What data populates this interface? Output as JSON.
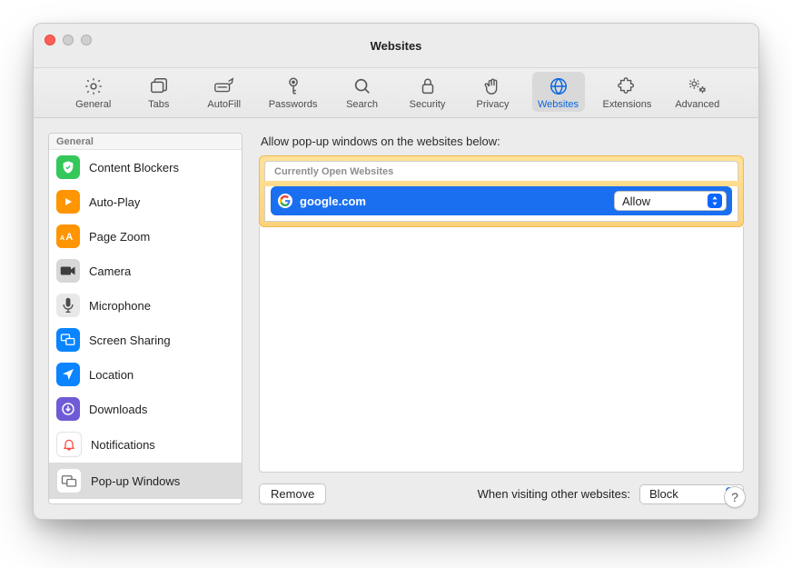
{
  "window": {
    "title": "Websites"
  },
  "toolbar": {
    "items": [
      {
        "label": "General",
        "icon": "gear-icon"
      },
      {
        "label": "Tabs",
        "icon": "tabs-icon"
      },
      {
        "label": "AutoFill",
        "icon": "autofill-icon"
      },
      {
        "label": "Passwords",
        "icon": "key-icon"
      },
      {
        "label": "Search",
        "icon": "search-icon"
      },
      {
        "label": "Security",
        "icon": "lock-icon"
      },
      {
        "label": "Privacy",
        "icon": "hand-icon"
      },
      {
        "label": "Websites",
        "icon": "globe-icon",
        "selected": true
      },
      {
        "label": "Extensions",
        "icon": "puzzle-icon"
      },
      {
        "label": "Advanced",
        "icon": "gears-icon"
      }
    ]
  },
  "sidebar": {
    "header": "General",
    "items": [
      {
        "label": "Content Blockers",
        "icon": "shield-icon",
        "bg": "#34c759"
      },
      {
        "label": "Auto-Play",
        "icon": "play-icon",
        "bg": "#ff9500"
      },
      {
        "label": "Page Zoom",
        "icon": "zoom-icon",
        "bg": "#ff9500"
      },
      {
        "label": "Camera",
        "icon": "camera-icon",
        "bg": "#5c5c5c"
      },
      {
        "label": "Microphone",
        "icon": "mic-icon",
        "bg": "#d5d5d5"
      },
      {
        "label": "Screen Sharing",
        "icon": "screenshare-icon",
        "bg": "#0a84ff"
      },
      {
        "label": "Location",
        "icon": "location-icon",
        "bg": "#0a84ff"
      },
      {
        "label": "Downloads",
        "icon": "download-icon",
        "bg": "#7e5bef"
      },
      {
        "label": "Notifications",
        "icon": "bell-icon",
        "bg": "#ffffff"
      },
      {
        "label": "Pop-up Windows",
        "icon": "popup-icon",
        "bg": "#ffffff",
        "selected": true
      }
    ]
  },
  "panel": {
    "heading": "Allow pop-up windows on the websites below:",
    "list_header": "Currently Open Websites",
    "rows": [
      {
        "site": "google.com",
        "value": "Allow"
      }
    ],
    "remove_label": "Remove",
    "other_label": "When visiting other websites:",
    "other_value": "Block"
  },
  "help": "?"
}
